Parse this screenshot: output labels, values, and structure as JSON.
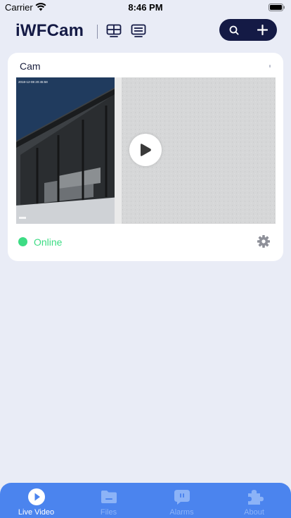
{
  "status_bar": {
    "carrier": "Carrier",
    "time": "8:46 PM"
  },
  "header": {
    "app_name": "iWFCam",
    "icons": [
      "grid-view-icon",
      "list-view-icon",
      "search-icon",
      "plus-icon"
    ]
  },
  "camera_card": {
    "name": "Cam",
    "status": "Online",
    "status_color": "#3ddc84",
    "thumbnail_text": "2018-12-08 20:45:58",
    "icons": [
      "play-icon",
      "gear-icon"
    ]
  },
  "tab_bar": {
    "background": "#4b84ee",
    "tabs": [
      {
        "label": "Live Video",
        "icon": "play-circle-icon",
        "active": true
      },
      {
        "label": "Files",
        "icon": "folder-icon",
        "active": false
      },
      {
        "label": "Alarms",
        "icon": "alarm-chat-icon",
        "active": false
      },
      {
        "label": "About",
        "icon": "puzzle-icon",
        "active": false
      }
    ]
  }
}
